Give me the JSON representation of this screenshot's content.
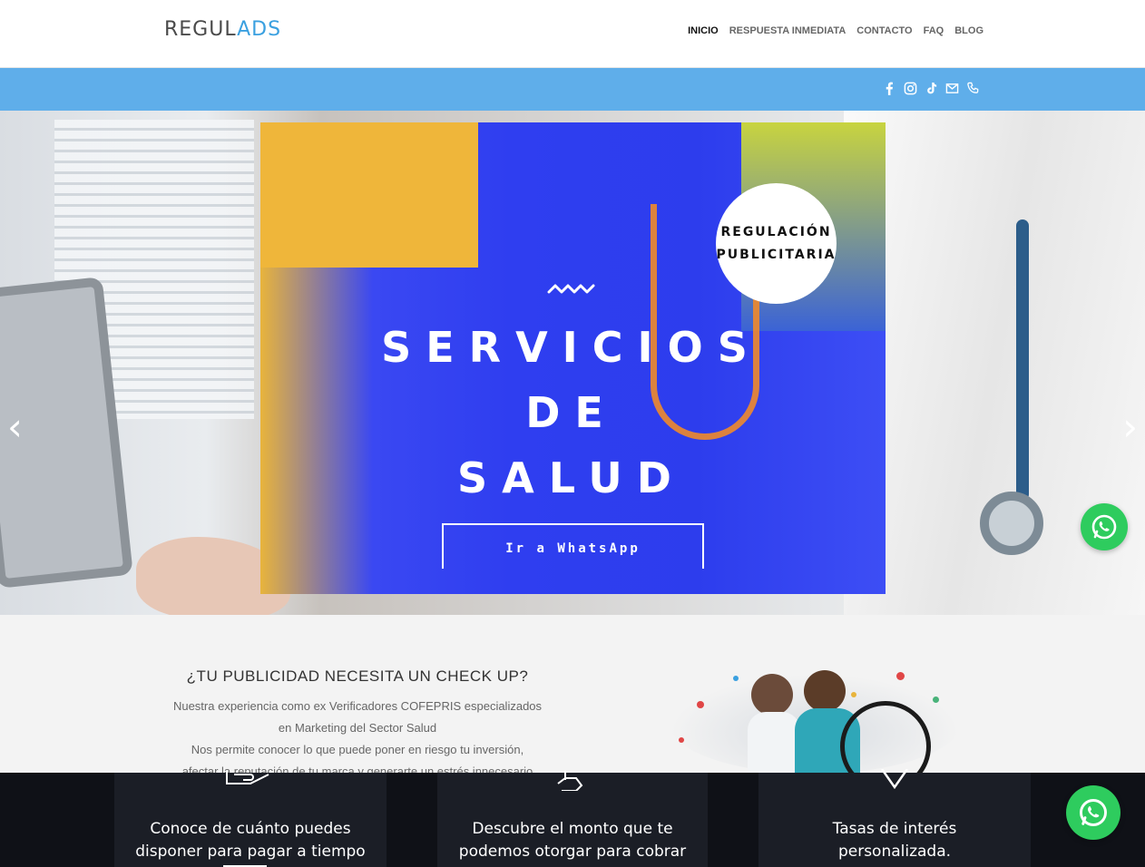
{
  "header": {
    "logo_part1": "REGUL",
    "logo_part2": "ADS",
    "nav": [
      {
        "label": "INICIO",
        "active": true
      },
      {
        "label": "RESPUESTA INMEDIATA"
      },
      {
        "label": "CONTACTO"
      },
      {
        "label": "FAQ"
      },
      {
        "label": "BLOG"
      }
    ]
  },
  "social_icons": [
    "facebook-icon",
    "instagram-icon",
    "tiktok-icon",
    "email-icon",
    "phone-icon"
  ],
  "hero": {
    "badge_line1": "REGULACIÓN",
    "badge_line2": "PUBLICITARIA",
    "title_line1": "SERVICIOS",
    "title_line2": "DE",
    "title_line3": "SALUD",
    "button_label": "Ir a WhatsApp",
    "prev_arrow": "‹",
    "next_arrow": "›"
  },
  "checkup": {
    "title": "¿TU PUBLICIDAD NECESITA UN CHECK UP?",
    "line1": "Nuestra experiencia como ex Verificadores COFEPRIS especializados",
    "line2": "en Marketing del Sector Salud",
    "line3": "Nos permite conocer lo que puede poner en riesgo tu inversión,",
    "line4": "afectar la reputación de tu marca y generarte un estrés innecesario"
  },
  "features": [
    {
      "line1": "Conoce de cuánto puedes",
      "line2": "disponer para pagar a tiempo",
      "icon": "hand-coins-icon"
    },
    {
      "line1": "Descubre el monto que te",
      "line2": "podemos otorgar para cobrar",
      "icon": "money-hand-icon"
    },
    {
      "line1": "Tasas de interés",
      "line2": "personalizada.",
      "icon": "percent-badge-icon"
    }
  ],
  "colors": {
    "accent_blue": "#5faeea",
    "whatsapp_green": "#2ecc5e",
    "overlay_blue": "#2f3ef0"
  }
}
